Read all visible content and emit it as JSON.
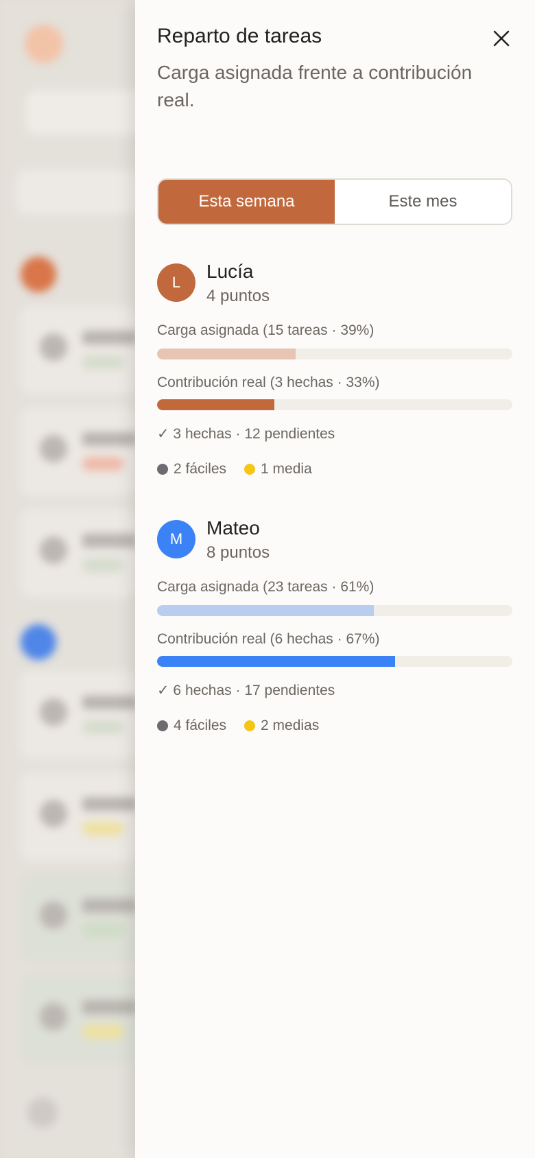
{
  "drawer": {
    "title": "Reparto de tareas",
    "subtitle": "Carga asignada frente a contribución real.",
    "close_icon": "close-icon"
  },
  "period": {
    "options": [
      "Esta semana",
      "Este mes"
    ],
    "selected": "Esta semana"
  },
  "colors": {
    "lucia_accent": "#c1693d",
    "lucia_light": "#e8c4b2",
    "mateo_accent": "#3b82f6",
    "mateo_light": "#b8cdf0",
    "easy_dot": "#6e6a72",
    "medium_dot": "#f5c518"
  },
  "members": [
    {
      "initial": "L",
      "name": "Lucía",
      "points": "4 puntos",
      "assigned_label": "Carga asignada (15 tareas · 39%)",
      "assigned_percent": 39,
      "contribution_label": "Contribución real (3 hechas · 33%)",
      "contribution_percent": 33,
      "summary": "✓ 3 hechas · 12 pendientes",
      "difficulty": [
        {
          "label": "2 fáciles",
          "kind": "easy"
        },
        {
          "label": "1 media",
          "kind": "medium"
        }
      ]
    },
    {
      "initial": "M",
      "name": "Mateo",
      "points": "8 puntos",
      "assigned_label": "Carga asignada (23 tareas · 61%)",
      "assigned_percent": 61,
      "contribution_label": "Contribución real (6 hechas · 67%)",
      "contribution_percent": 67,
      "summary": "✓ 6 hechas · 17 pendientes",
      "difficulty": [
        {
          "label": "4 fáciles",
          "kind": "easy"
        },
        {
          "label": "2 medias",
          "kind": "medium"
        }
      ]
    }
  ]
}
